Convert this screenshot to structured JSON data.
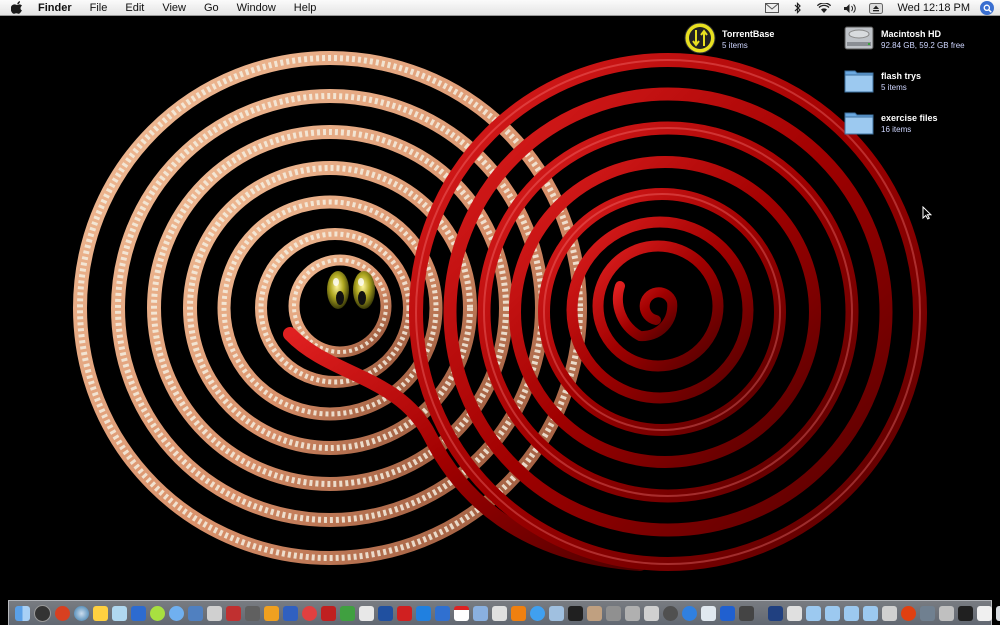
{
  "menubar": {
    "app_name": "Finder",
    "menus": [
      "File",
      "Edit",
      "View",
      "Go",
      "Window",
      "Help"
    ],
    "clock": "Wed 12:18 PM",
    "status_icons": [
      "mail-icon",
      "bluetooth-icon",
      "wifi-icon",
      "volume-icon",
      "eject-icon"
    ]
  },
  "desktop": {
    "icons": [
      {
        "name": "TorrentBase",
        "info": "5 items",
        "icon": "torrentbase-icon"
      },
      {
        "name": "Macintosh HD",
        "info": "92.84 GB, 59.2 GB free",
        "icon": "hard-drive-icon"
      },
      {
        "name": "flash trys",
        "info": "5 items",
        "icon": "folder-icon"
      },
      {
        "name": "exercise files",
        "info": "16 items",
        "icon": "folder-icon"
      }
    ]
  },
  "colors": {
    "menubar": "#f0f0f0",
    "desktop": "#000000",
    "red_spiral": "#a80000",
    "peach_spiral": "#e0a080",
    "torrent_yellow": "#e8e020",
    "folder_blue": "#8fc3ee"
  }
}
